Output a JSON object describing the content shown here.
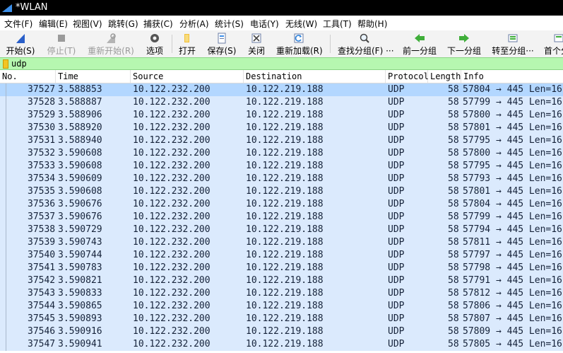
{
  "window": {
    "title": "*WLAN"
  },
  "menu": [
    "文件(F)",
    "编辑(E)",
    "视图(V)",
    "跳转(G)",
    "捕获(C)",
    "分析(A)",
    "统计(S)",
    "电话(Y)",
    "无线(W)",
    "工具(T)",
    "帮助(H)"
  ],
  "toolbar": {
    "start": "开始(S)",
    "stop": "停止(T)",
    "restart": "重新开始(R)",
    "options": "选项",
    "open": "打开",
    "save": "保存(S)",
    "close": "关闭",
    "reload": "重新加载(R)",
    "find": "查找分组(F) ···",
    "prev": "前一分组",
    "next": "下一分组",
    "goto": "转至分组···",
    "first": "首个分"
  },
  "filter": {
    "text": "udp"
  },
  "columns": [
    "No.",
    "Time",
    "Source",
    "Destination",
    "Protocol",
    "Length",
    "Info"
  ],
  "packets": [
    {
      "no": "37527",
      "time": "3.588853",
      "src": "10.122.232.200",
      "dst": "10.122.219.188",
      "proto": "UDP",
      "len": "58",
      "info": "57804 → 445 Len=16"
    },
    {
      "no": "37528",
      "time": "3.588887",
      "src": "10.122.232.200",
      "dst": "10.122.219.188",
      "proto": "UDP",
      "len": "58",
      "info": "57799 → 445 Len=16"
    },
    {
      "no": "37529",
      "time": "3.588906",
      "src": "10.122.232.200",
      "dst": "10.122.219.188",
      "proto": "UDP",
      "len": "58",
      "info": "57800 → 445 Len=16"
    },
    {
      "no": "37530",
      "time": "3.588920",
      "src": "10.122.232.200",
      "dst": "10.122.219.188",
      "proto": "UDP",
      "len": "58",
      "info": "57801 → 445 Len=16"
    },
    {
      "no": "37531",
      "time": "3.588940",
      "src": "10.122.232.200",
      "dst": "10.122.219.188",
      "proto": "UDP",
      "len": "58",
      "info": "57795 → 445 Len=16"
    },
    {
      "no": "37532",
      "time": "3.590608",
      "src": "10.122.232.200",
      "dst": "10.122.219.188",
      "proto": "UDP",
      "len": "58",
      "info": "57800 → 445 Len=16"
    },
    {
      "no": "37533",
      "time": "3.590608",
      "src": "10.122.232.200",
      "dst": "10.122.219.188",
      "proto": "UDP",
      "len": "58",
      "info": "57795 → 445 Len=16"
    },
    {
      "no": "37534",
      "time": "3.590609",
      "src": "10.122.232.200",
      "dst": "10.122.219.188",
      "proto": "UDP",
      "len": "58",
      "info": "57793 → 445 Len=16"
    },
    {
      "no": "37535",
      "time": "3.590608",
      "src": "10.122.232.200",
      "dst": "10.122.219.188",
      "proto": "UDP",
      "len": "58",
      "info": "57801 → 445 Len=16"
    },
    {
      "no": "37536",
      "time": "3.590676",
      "src": "10.122.232.200",
      "dst": "10.122.219.188",
      "proto": "UDP",
      "len": "58",
      "info": "57804 → 445 Len=16"
    },
    {
      "no": "37537",
      "time": "3.590676",
      "src": "10.122.232.200",
      "dst": "10.122.219.188",
      "proto": "UDP",
      "len": "58",
      "info": "57799 → 445 Len=16"
    },
    {
      "no": "37538",
      "time": "3.590729",
      "src": "10.122.232.200",
      "dst": "10.122.219.188",
      "proto": "UDP",
      "len": "58",
      "info": "57794 → 445 Len=16"
    },
    {
      "no": "37539",
      "time": "3.590743",
      "src": "10.122.232.200",
      "dst": "10.122.219.188",
      "proto": "UDP",
      "len": "58",
      "info": "57811 → 445 Len=16"
    },
    {
      "no": "37540",
      "time": "3.590744",
      "src": "10.122.232.200",
      "dst": "10.122.219.188",
      "proto": "UDP",
      "len": "58",
      "info": "57797 → 445 Len=16"
    },
    {
      "no": "37541",
      "time": "3.590783",
      "src": "10.122.232.200",
      "dst": "10.122.219.188",
      "proto": "UDP",
      "len": "58",
      "info": "57798 → 445 Len=16"
    },
    {
      "no": "37542",
      "time": "3.590821",
      "src": "10.122.232.200",
      "dst": "10.122.219.188",
      "proto": "UDP",
      "len": "58",
      "info": "57791 → 445 Len=16"
    },
    {
      "no": "37543",
      "time": "3.590833",
      "src": "10.122.232.200",
      "dst": "10.122.219.188",
      "proto": "UDP",
      "len": "58",
      "info": "57812 → 445 Len=16"
    },
    {
      "no": "37544",
      "time": "3.590865",
      "src": "10.122.232.200",
      "dst": "10.122.219.188",
      "proto": "UDP",
      "len": "58",
      "info": "57806 → 445 Len=16"
    },
    {
      "no": "37545",
      "time": "3.590893",
      "src": "10.122.232.200",
      "dst": "10.122.219.188",
      "proto": "UDP",
      "len": "58",
      "info": "57807 → 445 Len=16"
    },
    {
      "no": "37546",
      "time": "3.590916",
      "src": "10.122.232.200",
      "dst": "10.122.219.188",
      "proto": "UDP",
      "len": "58",
      "info": "57809 → 445 Len=16"
    },
    {
      "no": "37547",
      "time": "3.590941",
      "src": "10.122.232.200",
      "dst": "10.122.219.188",
      "proto": "UDP",
      "len": "58",
      "info": "57805 → 445 Len=16"
    }
  ],
  "colors": {
    "row_bg": "#dbeafd",
    "selected_bg": "#b3d7ff",
    "filter_valid_bg": "#b6f7b0"
  },
  "icons": [
    "app-fin-icon",
    "start-capture-icon",
    "stop-capture-icon",
    "restart-capture-icon",
    "options-gear-icon",
    "open-file-icon",
    "save-file-icon",
    "close-file-icon",
    "reload-icon",
    "find-packet-icon",
    "previous-packet-icon",
    "next-packet-icon",
    "goto-packet-icon",
    "first-packet-icon",
    "filter-bookmark-icon"
  ]
}
